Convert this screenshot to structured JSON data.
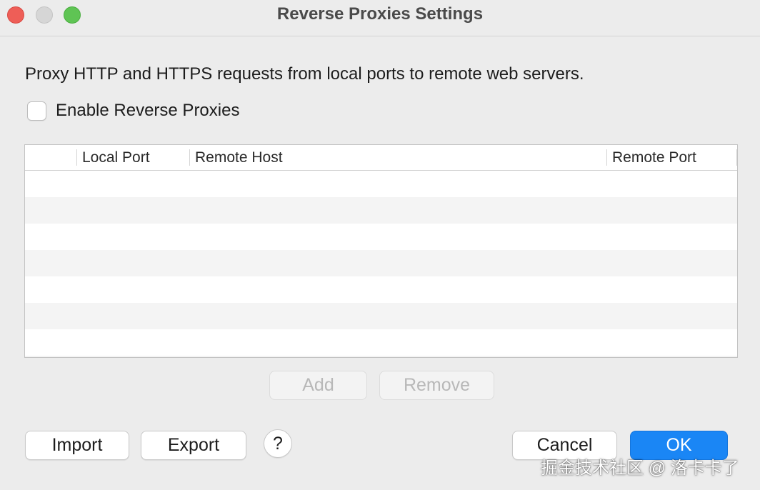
{
  "window": {
    "title": "Reverse Proxies Settings"
  },
  "description": "Proxy HTTP and HTTPS requests from local ports to remote web servers.",
  "enable_checkbox": {
    "label": "Enable Reverse Proxies",
    "checked": false
  },
  "table": {
    "columns": [
      "",
      "Local Port",
      "Remote Host",
      "Remote Port"
    ],
    "rows": []
  },
  "table_buttons": {
    "add_label": "Add",
    "remove_label": "Remove"
  },
  "footer": {
    "import_label": "Import",
    "export_label": "Export",
    "help_label": "?",
    "cancel_label": "Cancel",
    "ok_label": "OK"
  },
  "watermark": "掘金技术社区 @ 洛卡卡了",
  "colors": {
    "accent": "#1a86f5",
    "close": "#ee5e57",
    "maximize": "#5fc454"
  }
}
